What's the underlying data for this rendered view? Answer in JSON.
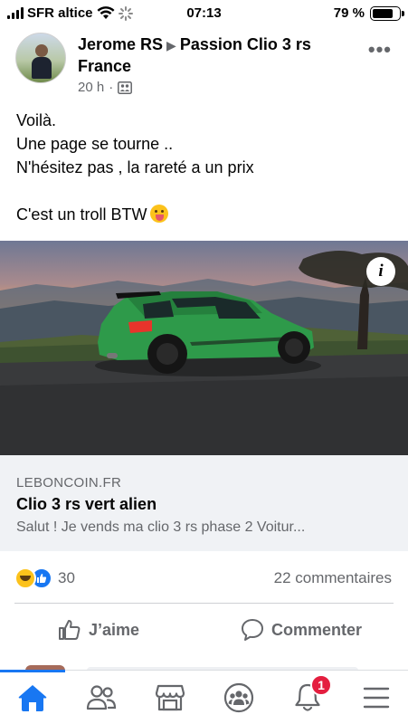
{
  "status_bar": {
    "carrier": "SFR altice",
    "time": "07:13",
    "battery_percent": "79 %",
    "battery_level": 0.79
  },
  "post": {
    "author": "Jerome RS",
    "group": "Passion Clio 3 rs France",
    "time": "20 h",
    "privacy_icon": "group-members-icon",
    "text_lines": [
      "Voilà.",
      "Une page se tourne ..",
      "N'hésitez pas , la rareté a un prix",
      "",
      "C'est un troll BTW"
    ],
    "emoji": "face-with-tongue"
  },
  "link_preview": {
    "domain": "LEBONCOIN.FR",
    "title": "Clio 3 rs vert alien",
    "description": "Salut ! Je vends ma clio 3 rs phase 2 Voitur..."
  },
  "engagement": {
    "reaction_icons": [
      "haha-reaction-icon",
      "like-reaction-icon"
    ],
    "reaction_count": "30",
    "comments": "22 commentaires"
  },
  "actions": {
    "like": "J’aime",
    "comment": "Commenter"
  },
  "tab_bar": {
    "active": "home",
    "notifications_badge": "1",
    "tabs": [
      "home-icon",
      "friends-icon",
      "marketplace-icon",
      "groups-icon",
      "notifications-icon",
      "menu-icon"
    ]
  },
  "colors": {
    "facebook_blue": "#1877f2",
    "text_primary": "#050505",
    "text_secondary": "#65676b",
    "badge_red": "#e41e3f",
    "car_green": "#2e9a4a"
  }
}
